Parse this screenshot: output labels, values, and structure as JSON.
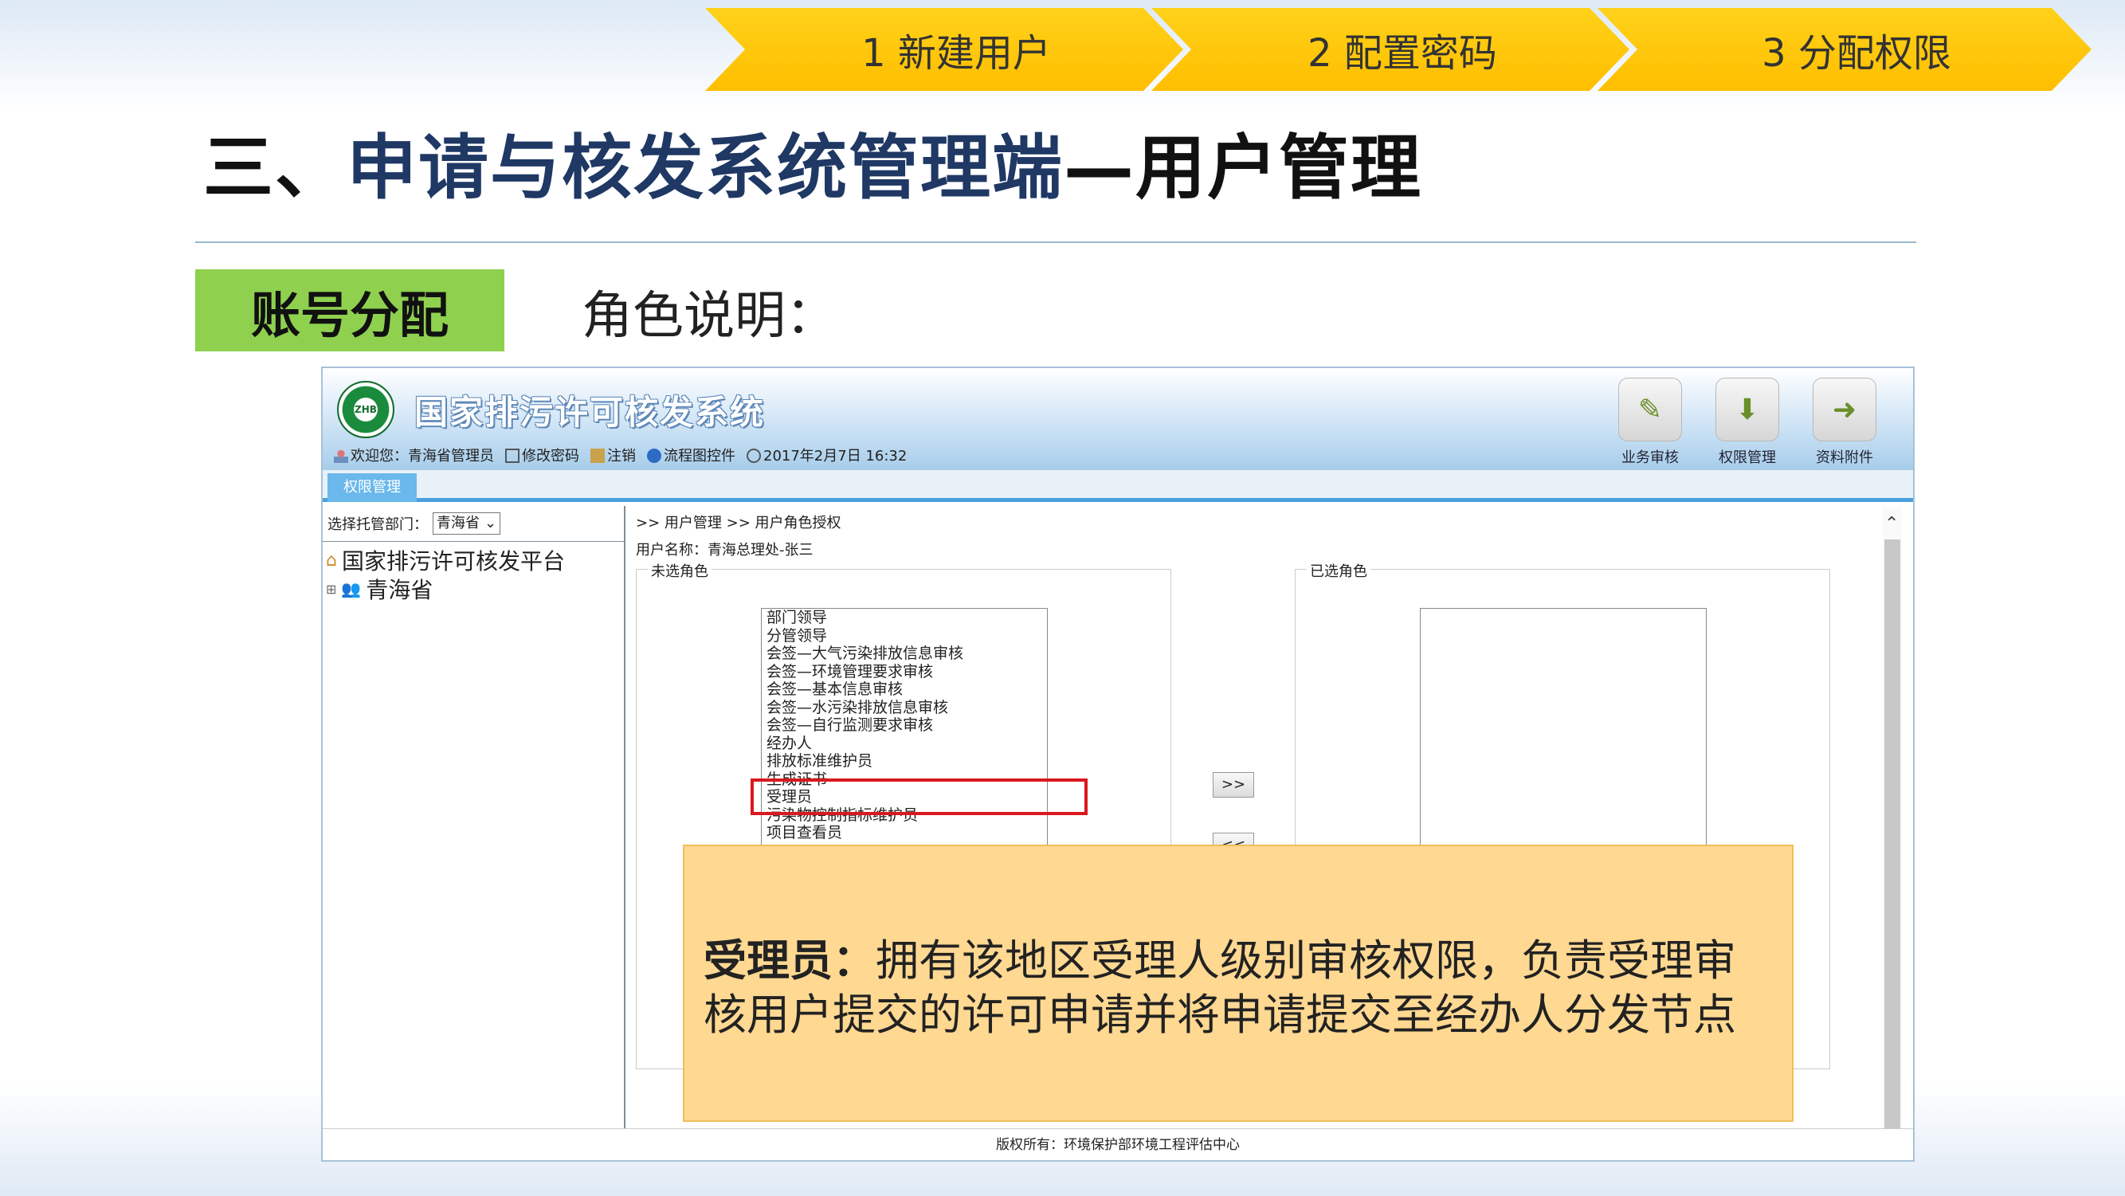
{
  "steps": [
    {
      "label": "1 新建用户"
    },
    {
      "label": "2 配置密码"
    },
    {
      "label": "3 分配权限"
    }
  ],
  "title": {
    "lead": "三、",
    "main": "申请与核发系统管理端",
    "tail": "—用户管理"
  },
  "badge": "账号分配",
  "subhead": "角色说明：",
  "app": {
    "title": "国家排污许可核发系统",
    "logo_text": "ZHB",
    "welcome": "欢迎您：青海省管理员",
    "change_password": "修改密码",
    "logout": "注销",
    "flow_control": "流程图控件",
    "datetime": "2017年2月7日 16:32",
    "top_buttons": [
      {
        "label": "业务审核",
        "icon": "edit-icon"
      },
      {
        "label": "权限管理",
        "icon": "download-icon"
      },
      {
        "label": "资料附件",
        "icon": "attachment-icon"
      }
    ],
    "tab": "权限管理",
    "dept_label": "选择托管部门：",
    "dept_value": "青海省",
    "tree": [
      {
        "label": "国家排污许可核发平台",
        "icon": "home-icon"
      },
      {
        "label": "青海省",
        "icon": "users-icon"
      }
    ],
    "breadcrumb": ">> 用户管理 >> 用户角色授权",
    "user_name": "用户名称：青海总理处-张三",
    "unselected_legend": "未选角色",
    "selected_legend": "已选角色",
    "roles": [
      "部门领导",
      "分管领导",
      "会签—大气污染排放信息审核",
      "会签—环境管理要求审核",
      "会签—基本信息审核",
      "会签—水污染排放信息审核",
      "会签—自行监测要求审核",
      "经办人",
      "排放标准维护员",
      "生成证书",
      "受理员",
      "污染物控制指标维护员",
      "项目查看员"
    ],
    "btn_add": ">>",
    "btn_remove": "<<",
    "footer": "版权所有：环境保护部环境工程评估中心"
  },
  "callout": {
    "term": "受理员：",
    "text": "拥有该地区受理人级别审核权限，负责受理审核用户提交的许可申请并将申请提交至经办人分发节点"
  }
}
